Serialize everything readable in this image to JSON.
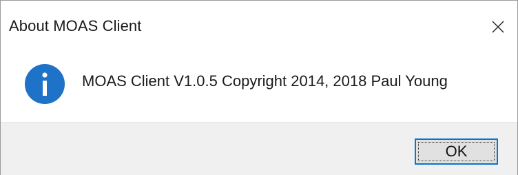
{
  "window": {
    "title": "About MOAS Client"
  },
  "icons": {
    "close": "close-icon",
    "info": "information-icon"
  },
  "message": {
    "text": "MOAS Client V1.0.5 Copyright 2014, 2018 Paul Young"
  },
  "buttons": {
    "ok_label": "OK"
  },
  "colors": {
    "info_icon": "#1e73c8",
    "button_focus_border": "#0078d7",
    "footer_background": "#f0f0f0"
  }
}
